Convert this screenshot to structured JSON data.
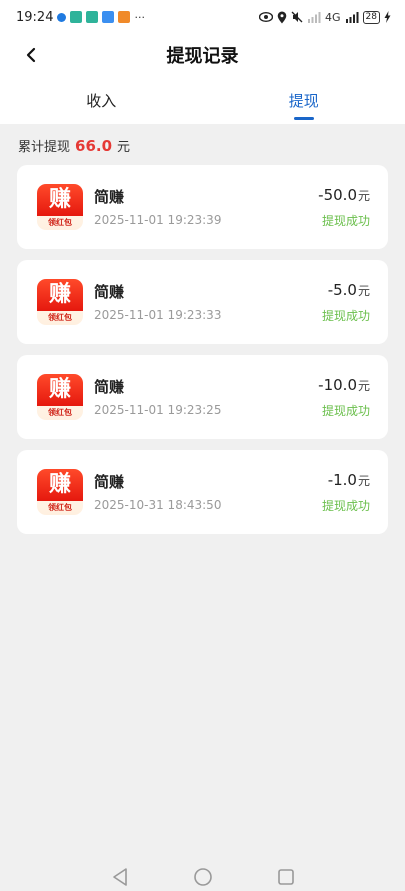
{
  "status_bar": {
    "time": "19:24",
    "more": "···",
    "signal_label": "4G",
    "battery": "28"
  },
  "header": {
    "title": "提现记录"
  },
  "tabs": [
    {
      "label": "收入",
      "active": false
    },
    {
      "label": "提现",
      "active": true
    }
  ],
  "summary": {
    "label": "累计提现",
    "amount": "66.0",
    "unit": "元"
  },
  "records": [
    {
      "app_logo_char": "赚",
      "app_logo_sub": "领红包",
      "name": "简赚",
      "time": "2025-11-01 19:23:39",
      "amount": "-50.0",
      "unit": "元",
      "status": "提现成功"
    },
    {
      "app_logo_char": "赚",
      "app_logo_sub": "领红包",
      "name": "简赚",
      "time": "2025-11-01 19:23:33",
      "amount": "-5.0",
      "unit": "元",
      "status": "提现成功"
    },
    {
      "app_logo_char": "赚",
      "app_logo_sub": "领红包",
      "name": "简赚",
      "time": "2025-11-01 19:23:25",
      "amount": "-10.0",
      "unit": "元",
      "status": "提现成功"
    },
    {
      "app_logo_char": "赚",
      "app_logo_sub": "领红包",
      "name": "简赚",
      "time": "2025-10-31 18:43:50",
      "amount": "-1.0",
      "unit": "元",
      "status": "提现成功"
    }
  ],
  "colors": {
    "accent": "#1a66c9",
    "summary_amount": "#e53935",
    "success": "#6abf4b",
    "background": "#f0f0f0"
  },
  "icons": {
    "back": "chevron-left-icon",
    "nav_back": "triangle-back-icon",
    "nav_home": "circle-home-icon",
    "nav_recents": "square-recents-icon"
  }
}
